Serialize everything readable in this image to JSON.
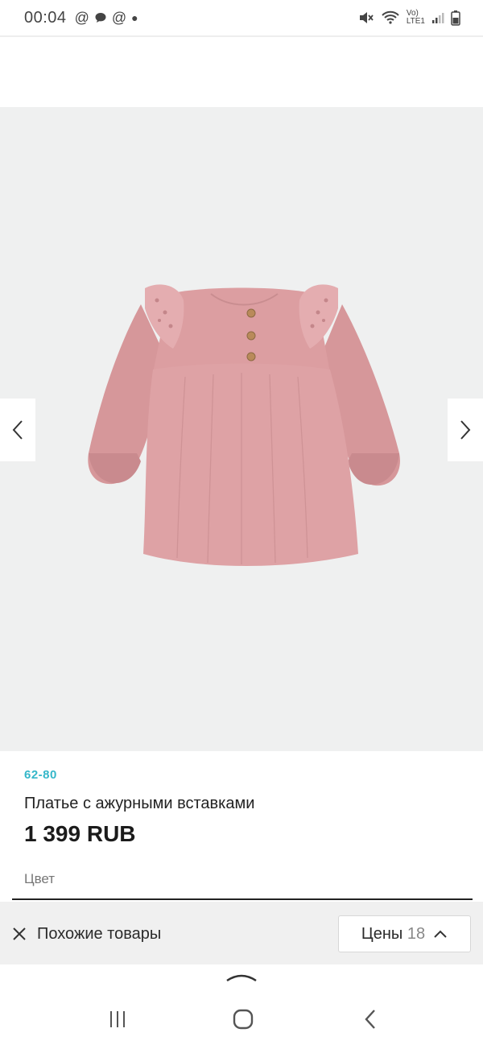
{
  "status_bar": {
    "time": "00:04",
    "network_label_top": "Vo)",
    "network_label_bottom": "LTE1"
  },
  "gallery": {
    "image_alt": "Платье с ажурными вставками",
    "prev_icon": "chevron-left-icon",
    "next_icon": "chevron-right-icon"
  },
  "product": {
    "sizes": "62-80",
    "title": "Платье с ажурными вставками",
    "price": "1 399 RUB",
    "color_label": "Цвет"
  },
  "bottom_panel": {
    "similar_label": "Похожие товары",
    "prices_label": "Цены",
    "prices_count": "18"
  },
  "colors": {
    "accent": "#35b7c9",
    "dress": "#d9999c",
    "background": "#eff0f0"
  }
}
